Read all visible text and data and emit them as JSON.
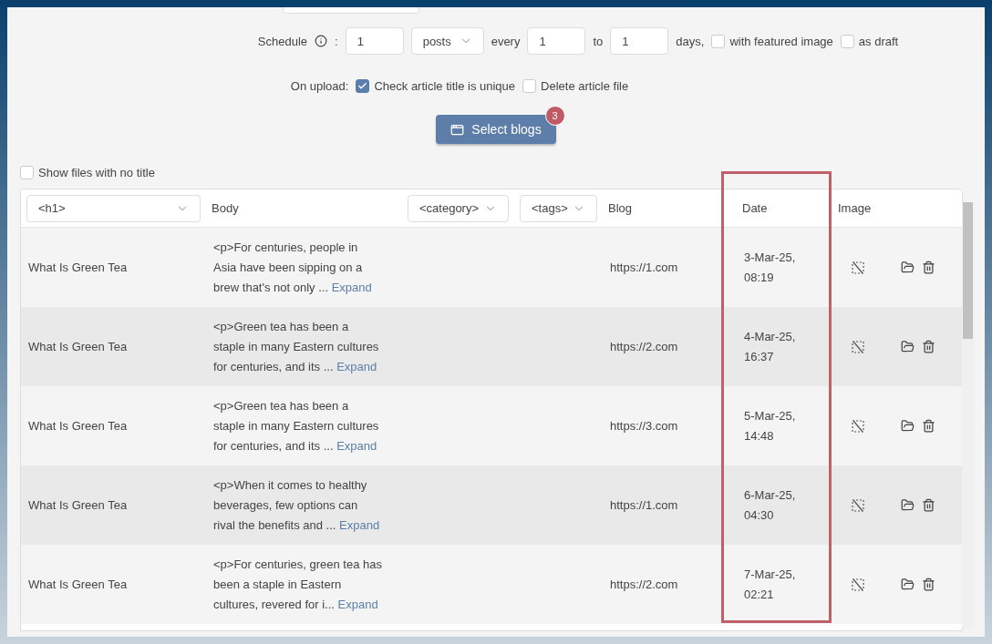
{
  "schedule": {
    "label": "Schedule",
    "colon": ":",
    "count": "1",
    "unit": "posts",
    "every_label": "every",
    "every_from": "1",
    "to_label": "to",
    "every_to": "1",
    "days_label": "days,",
    "options": [
      {
        "label": "with featured image",
        "checked": false
      },
      {
        "label": "as draft",
        "checked": false
      }
    ]
  },
  "on_upload": {
    "label": "On upload:",
    "options": [
      {
        "label": "Check article title is unique",
        "checked": true
      },
      {
        "label": "Delete article file",
        "checked": false
      }
    ]
  },
  "select_blogs": {
    "label": "Select blogs",
    "badge": "3"
  },
  "show_no_title": {
    "label": "Show files with no title",
    "checked": false
  },
  "table": {
    "columns": [
      {
        "kind": "select",
        "label": "<h1>"
      },
      {
        "kind": "text",
        "label": "Body"
      },
      {
        "kind": "select",
        "label": "<category>"
      },
      {
        "kind": "select",
        "label": "<tags>"
      },
      {
        "kind": "text",
        "label": "Blog"
      },
      {
        "kind": "text",
        "label": "Date"
      },
      {
        "kind": "text",
        "label": "Image"
      }
    ],
    "rows": [
      {
        "title": "What Is Green Tea",
        "body": "<p>For centuries, people in Asia have been sipping on a brew that's not only ...",
        "expand": "Expand",
        "blog": "https://1.com",
        "date": "3-Mar-25, 08:19"
      },
      {
        "title": "What Is Green Tea",
        "body": "<p>Green tea has been a staple in many Eastern cultures for centuries, and its ...",
        "expand": "Expand",
        "blog": "https://2.com",
        "date": "4-Mar-25, 16:37"
      },
      {
        "title": "What Is Green Tea",
        "body": "<p>Green tea has been a staple in many Eastern cultures for centuries, and its ...",
        "expand": "Expand",
        "blog": "https://3.com",
        "date": "5-Mar-25, 14:48"
      },
      {
        "title": "What Is Green Tea",
        "body": "<p>When it comes to healthy beverages, few options can rival the benefits and ...",
        "expand": "Expand",
        "blog": "https://1.com",
        "date": "6-Mar-25, 04:30"
      },
      {
        "title": "What Is Green Tea",
        "body": "<p>For centuries, green tea has been a staple in Eastern cultures, revered for i...",
        "expand": "Expand",
        "blog": "https://2.com",
        "date": "7-Mar-25, 02:21"
      }
    ]
  }
}
